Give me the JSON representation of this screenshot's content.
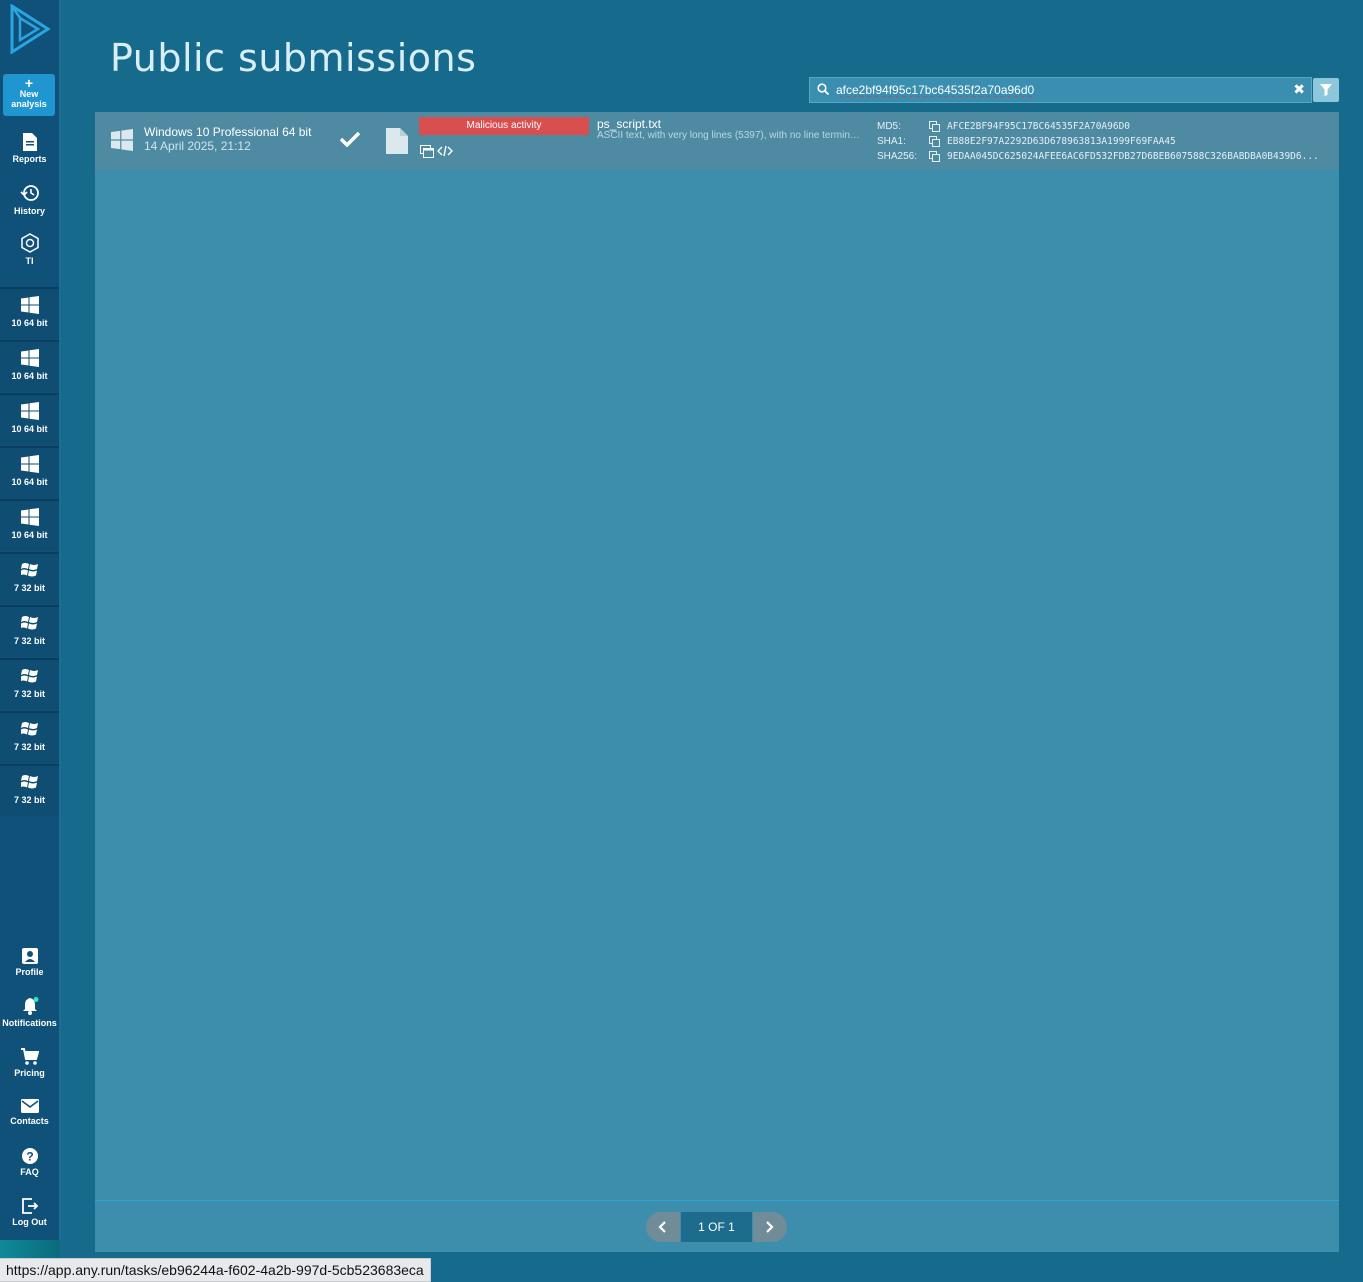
{
  "sidebar": {
    "new_analysis_plus": "+",
    "new_analysis_line1": "New",
    "new_analysis_line2": "analysis",
    "nav": [
      {
        "label": "Reports",
        "icon": "document-icon"
      },
      {
        "label": "History",
        "icon": "history-icon"
      },
      {
        "label": "TI",
        "icon": "threat-intel-icon"
      }
    ],
    "os_items": [
      {
        "label": "10 64 bit",
        "icon": "windows10-icon"
      },
      {
        "label": "10 64 bit",
        "icon": "windows10-icon"
      },
      {
        "label": "10 64 bit",
        "icon": "windows10-icon"
      },
      {
        "label": "10 64 bit",
        "icon": "windows10-icon"
      },
      {
        "label": "10 64 bit",
        "icon": "windows10-icon"
      },
      {
        "label": "7 32 bit",
        "icon": "windows7-icon"
      },
      {
        "label": "7 32 bit",
        "icon": "windows7-icon"
      },
      {
        "label": "7 32 bit",
        "icon": "windows7-icon"
      },
      {
        "label": "7 32 bit",
        "icon": "windows7-icon"
      },
      {
        "label": "7 32 bit",
        "icon": "windows7-icon"
      }
    ],
    "bottom": [
      {
        "label": "Profile",
        "icon": "profile-icon"
      },
      {
        "label": "Notifications",
        "icon": "bell-icon"
      },
      {
        "label": "Pricing",
        "icon": "cart-icon"
      },
      {
        "label": "Contacts",
        "icon": "mail-icon"
      },
      {
        "label": "FAQ",
        "icon": "help-icon"
      },
      {
        "label": "Log Out",
        "icon": "logout-icon"
      }
    ]
  },
  "page": {
    "title": "Public submissions"
  },
  "search": {
    "value": "afce2bf94f95c17bc64535f2a70a96d0",
    "clear_symbol": "✖"
  },
  "results": [
    {
      "os_name": "Windows 10 Professional 64 bit",
      "date": "14 April 2025, 21:12",
      "verdict": "Malicious activity",
      "verdict_color": "#d94f4f",
      "file_name": "ps_script.txt",
      "file_desc": "ASCII text, with very long lines (5397), with no line termina...",
      "md5_label": "MD5:",
      "md5": "AFCE2BF94F95C17BC64535F2A70A96D0",
      "sha1_label": "SHA1:",
      "sha1": "EB88E2F97A2292D63D678963813A1999F69FAA45",
      "sha256_label": "SHA256:",
      "sha256": "9EDAA045DC625024AFEE6AC6FD532FDB27D6BEB607588C326BABDBA0B439D6..."
    }
  ],
  "pagination": {
    "indicator": "1 OF 1"
  },
  "status_bar": {
    "url": "https://app.any.run/tasks/eb96244a-f602-4a2b-997d-5cb523683eca"
  },
  "colors": {
    "background": "#166a8c",
    "sidebar": "#10517a",
    "accent": "#1f96d0",
    "malicious": "#d94f4f"
  }
}
